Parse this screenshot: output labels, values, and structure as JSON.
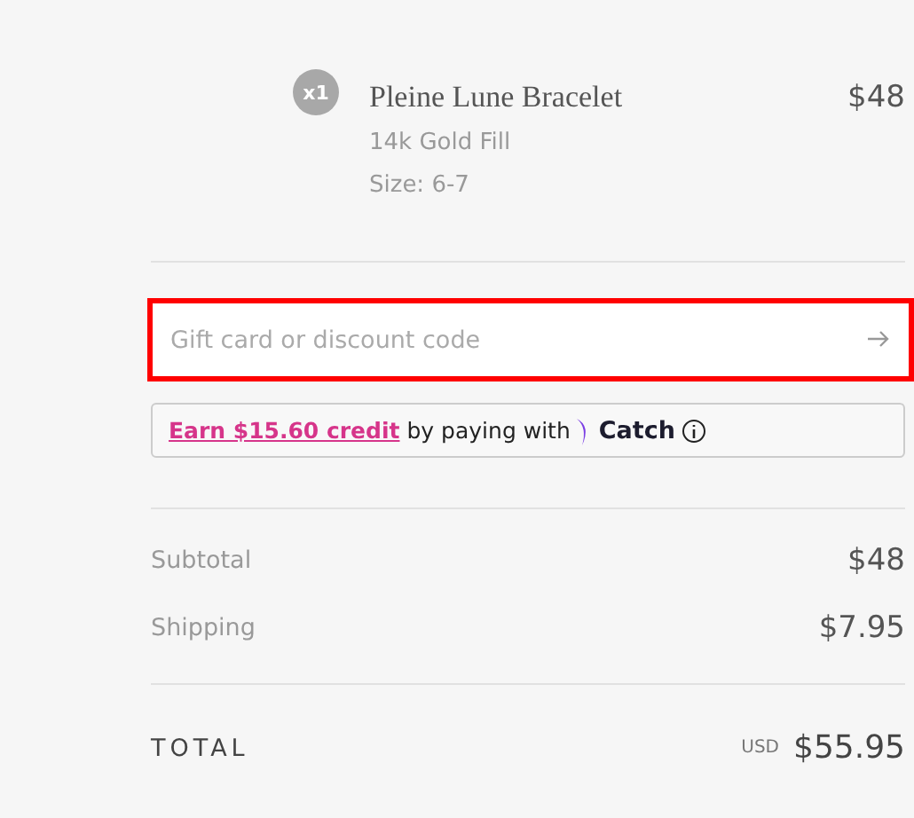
{
  "item": {
    "quantity": "x1",
    "name": "Pleine Lune Bracelet",
    "variant": "14k Gold Fill",
    "size": "Size: 6-7",
    "price": "$48"
  },
  "discount": {
    "placeholder": "Gift card or discount code",
    "highlighted": true
  },
  "catch_offer": {
    "link": "Earn $15.60 credit",
    "text": "by paying with",
    "brand": "Catch"
  },
  "summary": [
    {
      "label": "Subtotal",
      "value": "$48"
    },
    {
      "label": "Shipping",
      "value": "$7.95"
    }
  ],
  "total": {
    "label": "TOTAL",
    "currency": "USD",
    "value": "$55.95"
  }
}
